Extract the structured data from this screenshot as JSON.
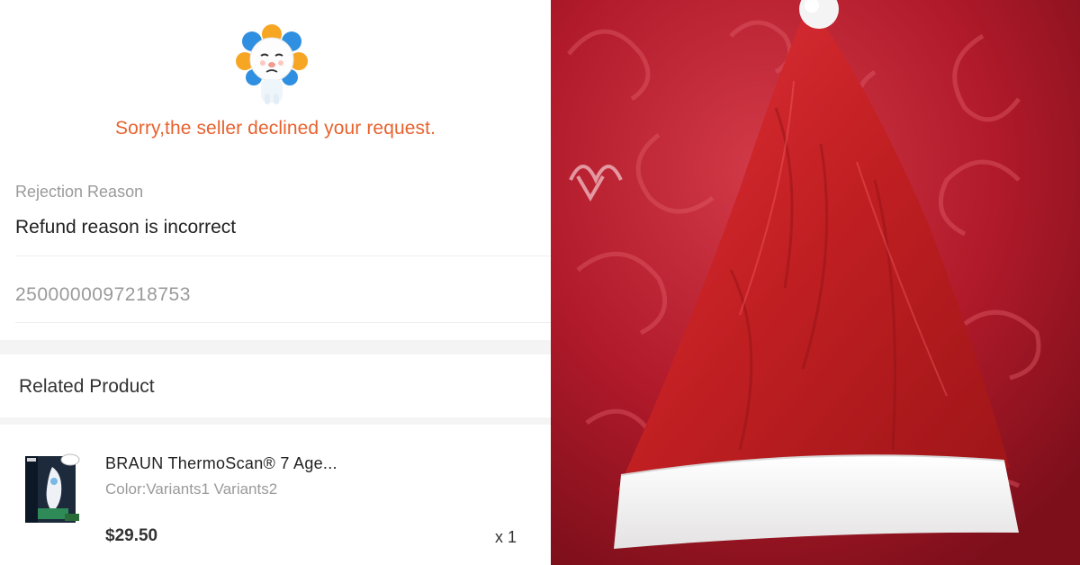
{
  "refund_status": {
    "mascot_icon": "sad-lion-mascot-icon",
    "message": "Sorry,the seller declined your request.",
    "rejection_reason_label": "Rejection Reason",
    "rejection_reason": "Refund reason is incorrect",
    "request_id": "2500000097218753"
  },
  "related_product": {
    "section_title": "Related Product",
    "name": "BRAUN ThermoScan® 7 Age...",
    "variant": "Color:Variants1 Variants2",
    "price": "$29.50",
    "quantity": "x 1",
    "thumbnail_icon": "thermometer-product-box-icon"
  },
  "photo": {
    "subject_icon": "santa-hat-photo"
  },
  "colors": {
    "accent_orange": "#e8622e",
    "muted_text": "#9a9a9a",
    "hat_red": "#c01f22",
    "background_red": "#b11a2a"
  }
}
